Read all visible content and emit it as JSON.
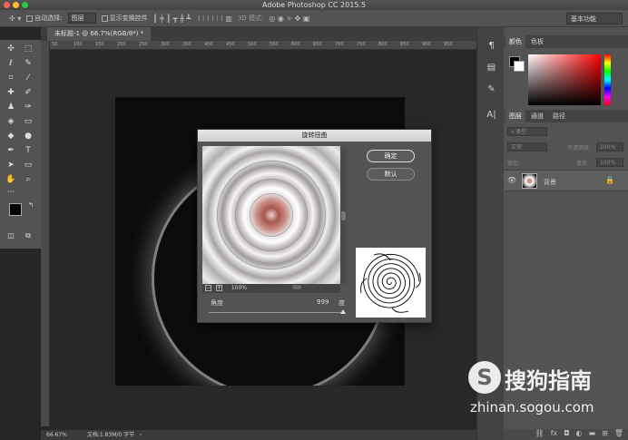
{
  "titlebar": {
    "title": "Adobe Photoshop CC 2015.5"
  },
  "options": {
    "auto_select_label": "自动选择:",
    "auto_select_value": "图层",
    "show_transform_label": "显示变换控件",
    "mode_3d": "3D 模式:",
    "workspace": "基本功能"
  },
  "document": {
    "tab_label": "未标题-1 @ 66.7%(RGB/8*) *",
    "ruler_ticks": [
      "50",
      "100",
      "150",
      "200",
      "250",
      "300",
      "350",
      "400",
      "450",
      "500",
      "550",
      "600",
      "650",
      "700",
      "750",
      "800",
      "850",
      "900",
      "950"
    ],
    "zoom": "66.67%",
    "doc_info": "文档:1.83M/0 字节"
  },
  "panels": {
    "color_tab": "颜色",
    "swatch_tab": "色板",
    "layers_tab": "图层",
    "channels_tab": "通道",
    "paths_tab": "路径",
    "kind_placeholder": "类型",
    "blend_mode": "正常",
    "opacity_label": "不透明度:",
    "opacity_value": "100%",
    "lock_label": "锁定:",
    "fill_label": "填充:",
    "fill_value": "100%",
    "layer_name": "背景"
  },
  "dialog": {
    "title": "旋转扭曲",
    "ok_label": "确定",
    "default_label": "默认",
    "zoom": "100%",
    "angle_label": "角度",
    "angle_value": "999",
    "angle_unit": "度",
    "angle_slider_fraction": 1.0
  },
  "watermark": {
    "logo_letter": "S",
    "brand": "搜狗指南",
    "url": "zhinan.sogou.com"
  }
}
